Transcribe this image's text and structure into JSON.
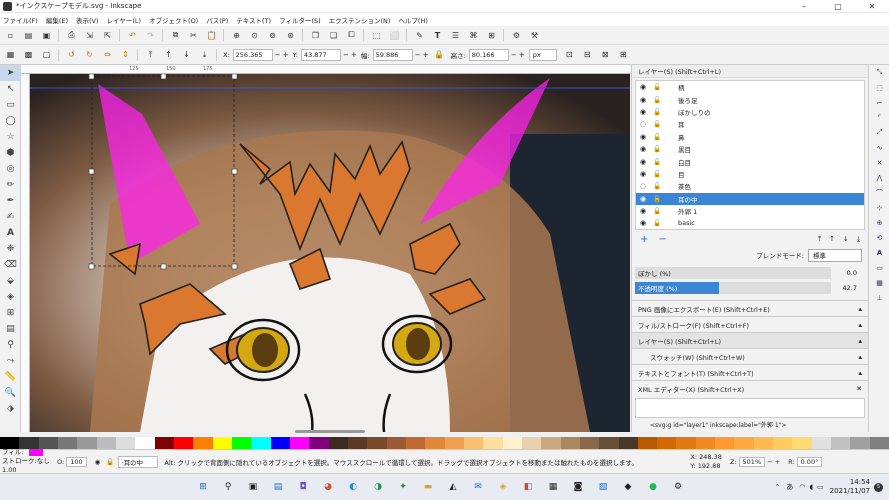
{
  "window": {
    "title": "*インクスケープモデル.svg - Inkscape",
    "minimize": "–",
    "maximize": "▢",
    "close": "✕"
  },
  "menu": [
    "ファイル(F)",
    "編集(E)",
    "表示(V)",
    "レイヤー(L)",
    "オブジェクト(O)",
    "パス(P)",
    "テキスト(T)",
    "フィルター(S)",
    "エクステンション(N)",
    "ヘルプ(H)"
  ],
  "controls": {
    "x_label": "X:",
    "x": "256.365",
    "y_label": "Y:",
    "y": "43.877",
    "w_label": "幅:",
    "w": "59.886",
    "h_label": "高さ:",
    "h": "80.166",
    "unit": "px"
  },
  "ruler_ticks": [
    "125",
    "150",
    "175"
  ],
  "layers_panel": {
    "title": "レイヤー(S) (Shift+Ctrl+L)",
    "layers": [
      {
        "name": "柄",
        "hidden": false
      },
      {
        "name": "後ろ足",
        "hidden": false
      },
      {
        "name": "ぼかしりの",
        "hidden": false
      },
      {
        "name": "耳",
        "hidden": true
      },
      {
        "name": "鼻",
        "hidden": false
      },
      {
        "name": "黒目",
        "hidden": false
      },
      {
        "name": "白目",
        "hidden": false
      },
      {
        "name": "目",
        "hidden": false
      },
      {
        "name": "茶色",
        "hidden": true
      },
      {
        "name": "耳の中",
        "hidden": false,
        "selected": true
      },
      {
        "name": "外郭 1",
        "hidden": false
      },
      {
        "name": "basic",
        "hidden": false
      }
    ],
    "add": "+",
    "remove": "−",
    "blend_label": "ブレンドモード:",
    "blend_value": "標準",
    "blur_label": "ぼかし (%)",
    "blur_value": "0.0",
    "opacity_label": "不透明度 (%)",
    "opacity_value": "42.7",
    "opacity": 0.427
  },
  "docks": [
    {
      "label": "PNG 画像にエクスポート(E) (Shift+Ctrl+E)",
      "sub": false
    },
    {
      "label": "フィル/ストローク(F) (Shift+Ctrl+F)",
      "sub": false
    },
    {
      "label": "レイヤー(S) (Shift+Ctrl+L)",
      "sub": false
    },
    {
      "label": "スウォッチ(W) (Shift+Ctrl+W)",
      "sub": true
    },
    {
      "label": "テキストとフォント(T) (Shift+Ctrl+T)",
      "sub": false
    },
    {
      "label": "XML エディター(X) (Shift+Ctrl+X)",
      "sub": false
    }
  ],
  "xml_node": "<svg:g id=\"layer1\" inkscape:label=\"外郭 1\">",
  "palette": [
    "#000000",
    "#333333",
    "#555555",
    "#777777",
    "#999999",
    "#bbbbbb",
    "#dddddd",
    "#ffffff",
    "#7f0000",
    "#ff0000",
    "#ff7f00",
    "#ffff00",
    "#00ff00",
    "#00ffff",
    "#0000ff",
    "#ff00ff",
    "#7f007f",
    "#3d2b1f",
    "#5a3a22",
    "#7a4a2a",
    "#9a5a32",
    "#c06a32",
    "#e0883a",
    "#f0a050",
    "#f8c070",
    "#fce0a0",
    "#fff0d0",
    "#e8d0b0",
    "#c8a880",
    "#a88860",
    "#886848",
    "#685038",
    "#483828",
    "#b85a00",
    "#d06a00",
    "#e07a10",
    "#f08a20",
    "#ff9a30",
    "#ffaa40",
    "#ffba50",
    "#ffca60",
    "#ffda70",
    "#e0e0e0",
    "#c0c0c0",
    "#a0a0a0",
    "#808080"
  ],
  "status": {
    "fill_label": "フィル:",
    "stroke_label": "ストローク:",
    "stroke_value": "なし 1.00",
    "fill_color": "#ff00ff",
    "opacity_label": "O:",
    "opacity_value": "100",
    "layer_value": "·耳の中",
    "message": "Alt: クリックで背面側に隠れているオブジェクトを選択。マウススクロールで循環して選択。ドラッグで選択オブジェクトを移動または触れたものを選択します。",
    "x_label": "X:",
    "x_value": "248.38",
    "y_label": "Y:",
    "y_value": "192.88",
    "zoom_label": "Z:",
    "zoom": "501%",
    "rot_label": "R:",
    "rotation": "0.00°"
  },
  "taskbar": {
    "time": "14:54",
    "date": "2021/11/07",
    "lang": "あ"
  }
}
